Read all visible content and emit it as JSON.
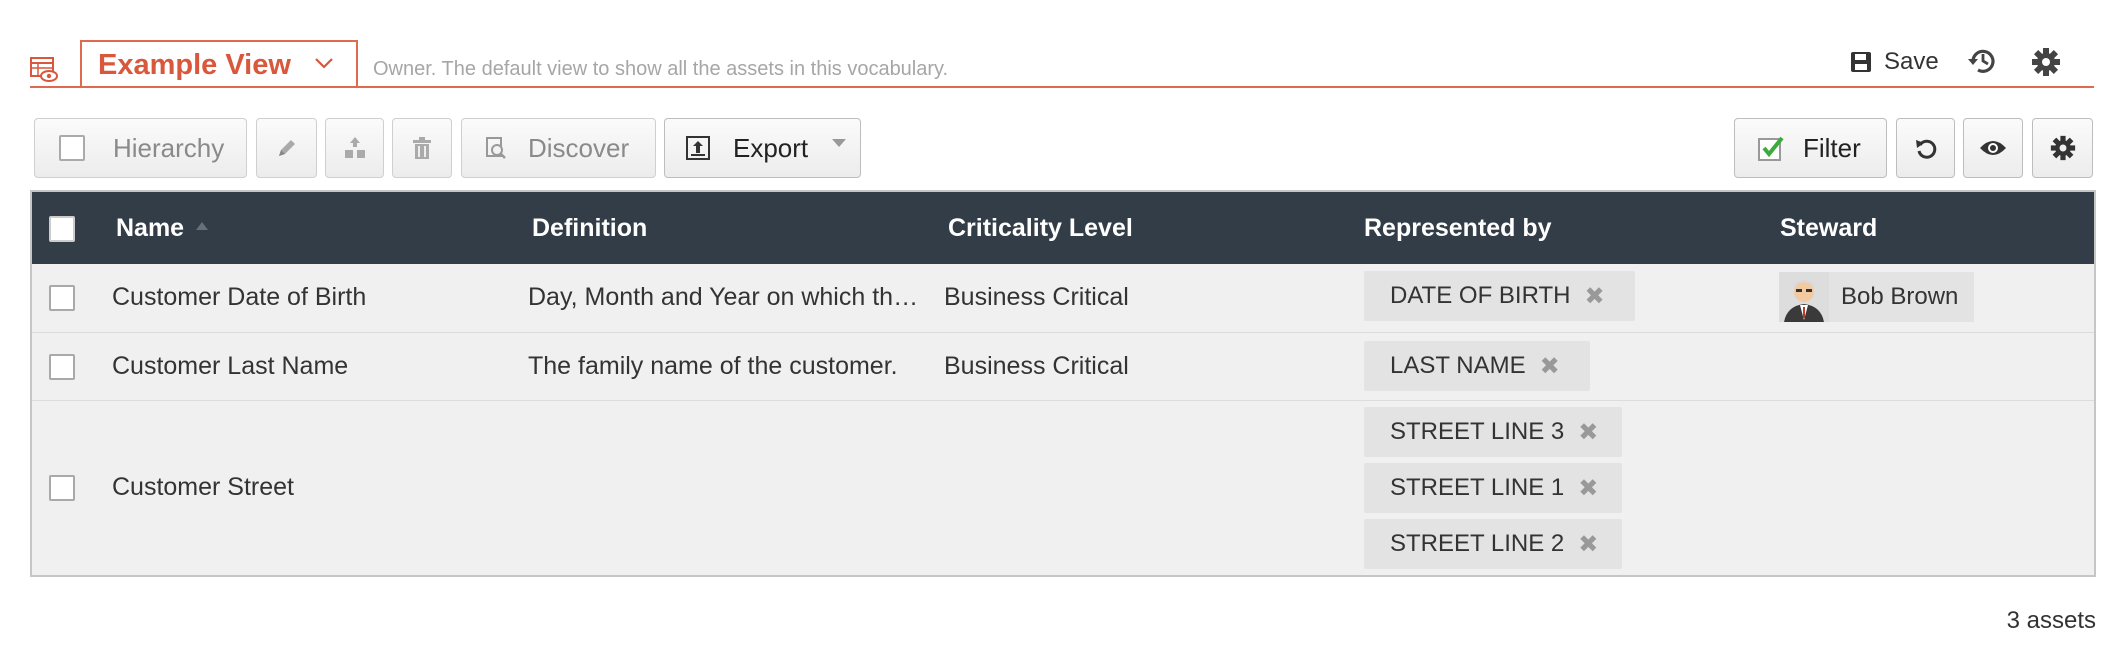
{
  "view": {
    "name": "Example View",
    "description": "Owner. The default view to show all the assets in this vocabulary.",
    "icon": "table-eye-icon"
  },
  "top_actions": {
    "save_label": "Save"
  },
  "toolbar": {
    "hierarchy_label": "Hierarchy",
    "discover_label": "Discover",
    "export_label": "Export",
    "filter_label": "Filter"
  },
  "table": {
    "columns": [
      "Name",
      "Definition",
      "Criticality Level",
      "Represented by",
      "Steward"
    ],
    "rows": [
      {
        "name": "Customer Date of Birth",
        "definition": "Day, Month and Year on which the customer was born.",
        "criticality": "Business Critical",
        "represented_by": [
          "DATE OF BIRTH"
        ],
        "steward": "Bob Brown"
      },
      {
        "name": "Customer Last Name",
        "definition": "The family name of the customer.",
        "criticality": "Business Critical",
        "represented_by": [
          "LAST NAME"
        ],
        "steward": ""
      },
      {
        "name": "Customer Street",
        "definition": "",
        "criticality": "",
        "represented_by": [
          "STREET LINE 3",
          "STREET LINE 1",
          "STREET LINE 2"
        ],
        "steward": ""
      }
    ]
  },
  "footer": {
    "count": "3 assets"
  },
  "colors": {
    "accent": "#e06a50",
    "header_bg": "#333d47",
    "row_bg": "#f0f0f0",
    "tag_bg": "#e3e3e3"
  }
}
